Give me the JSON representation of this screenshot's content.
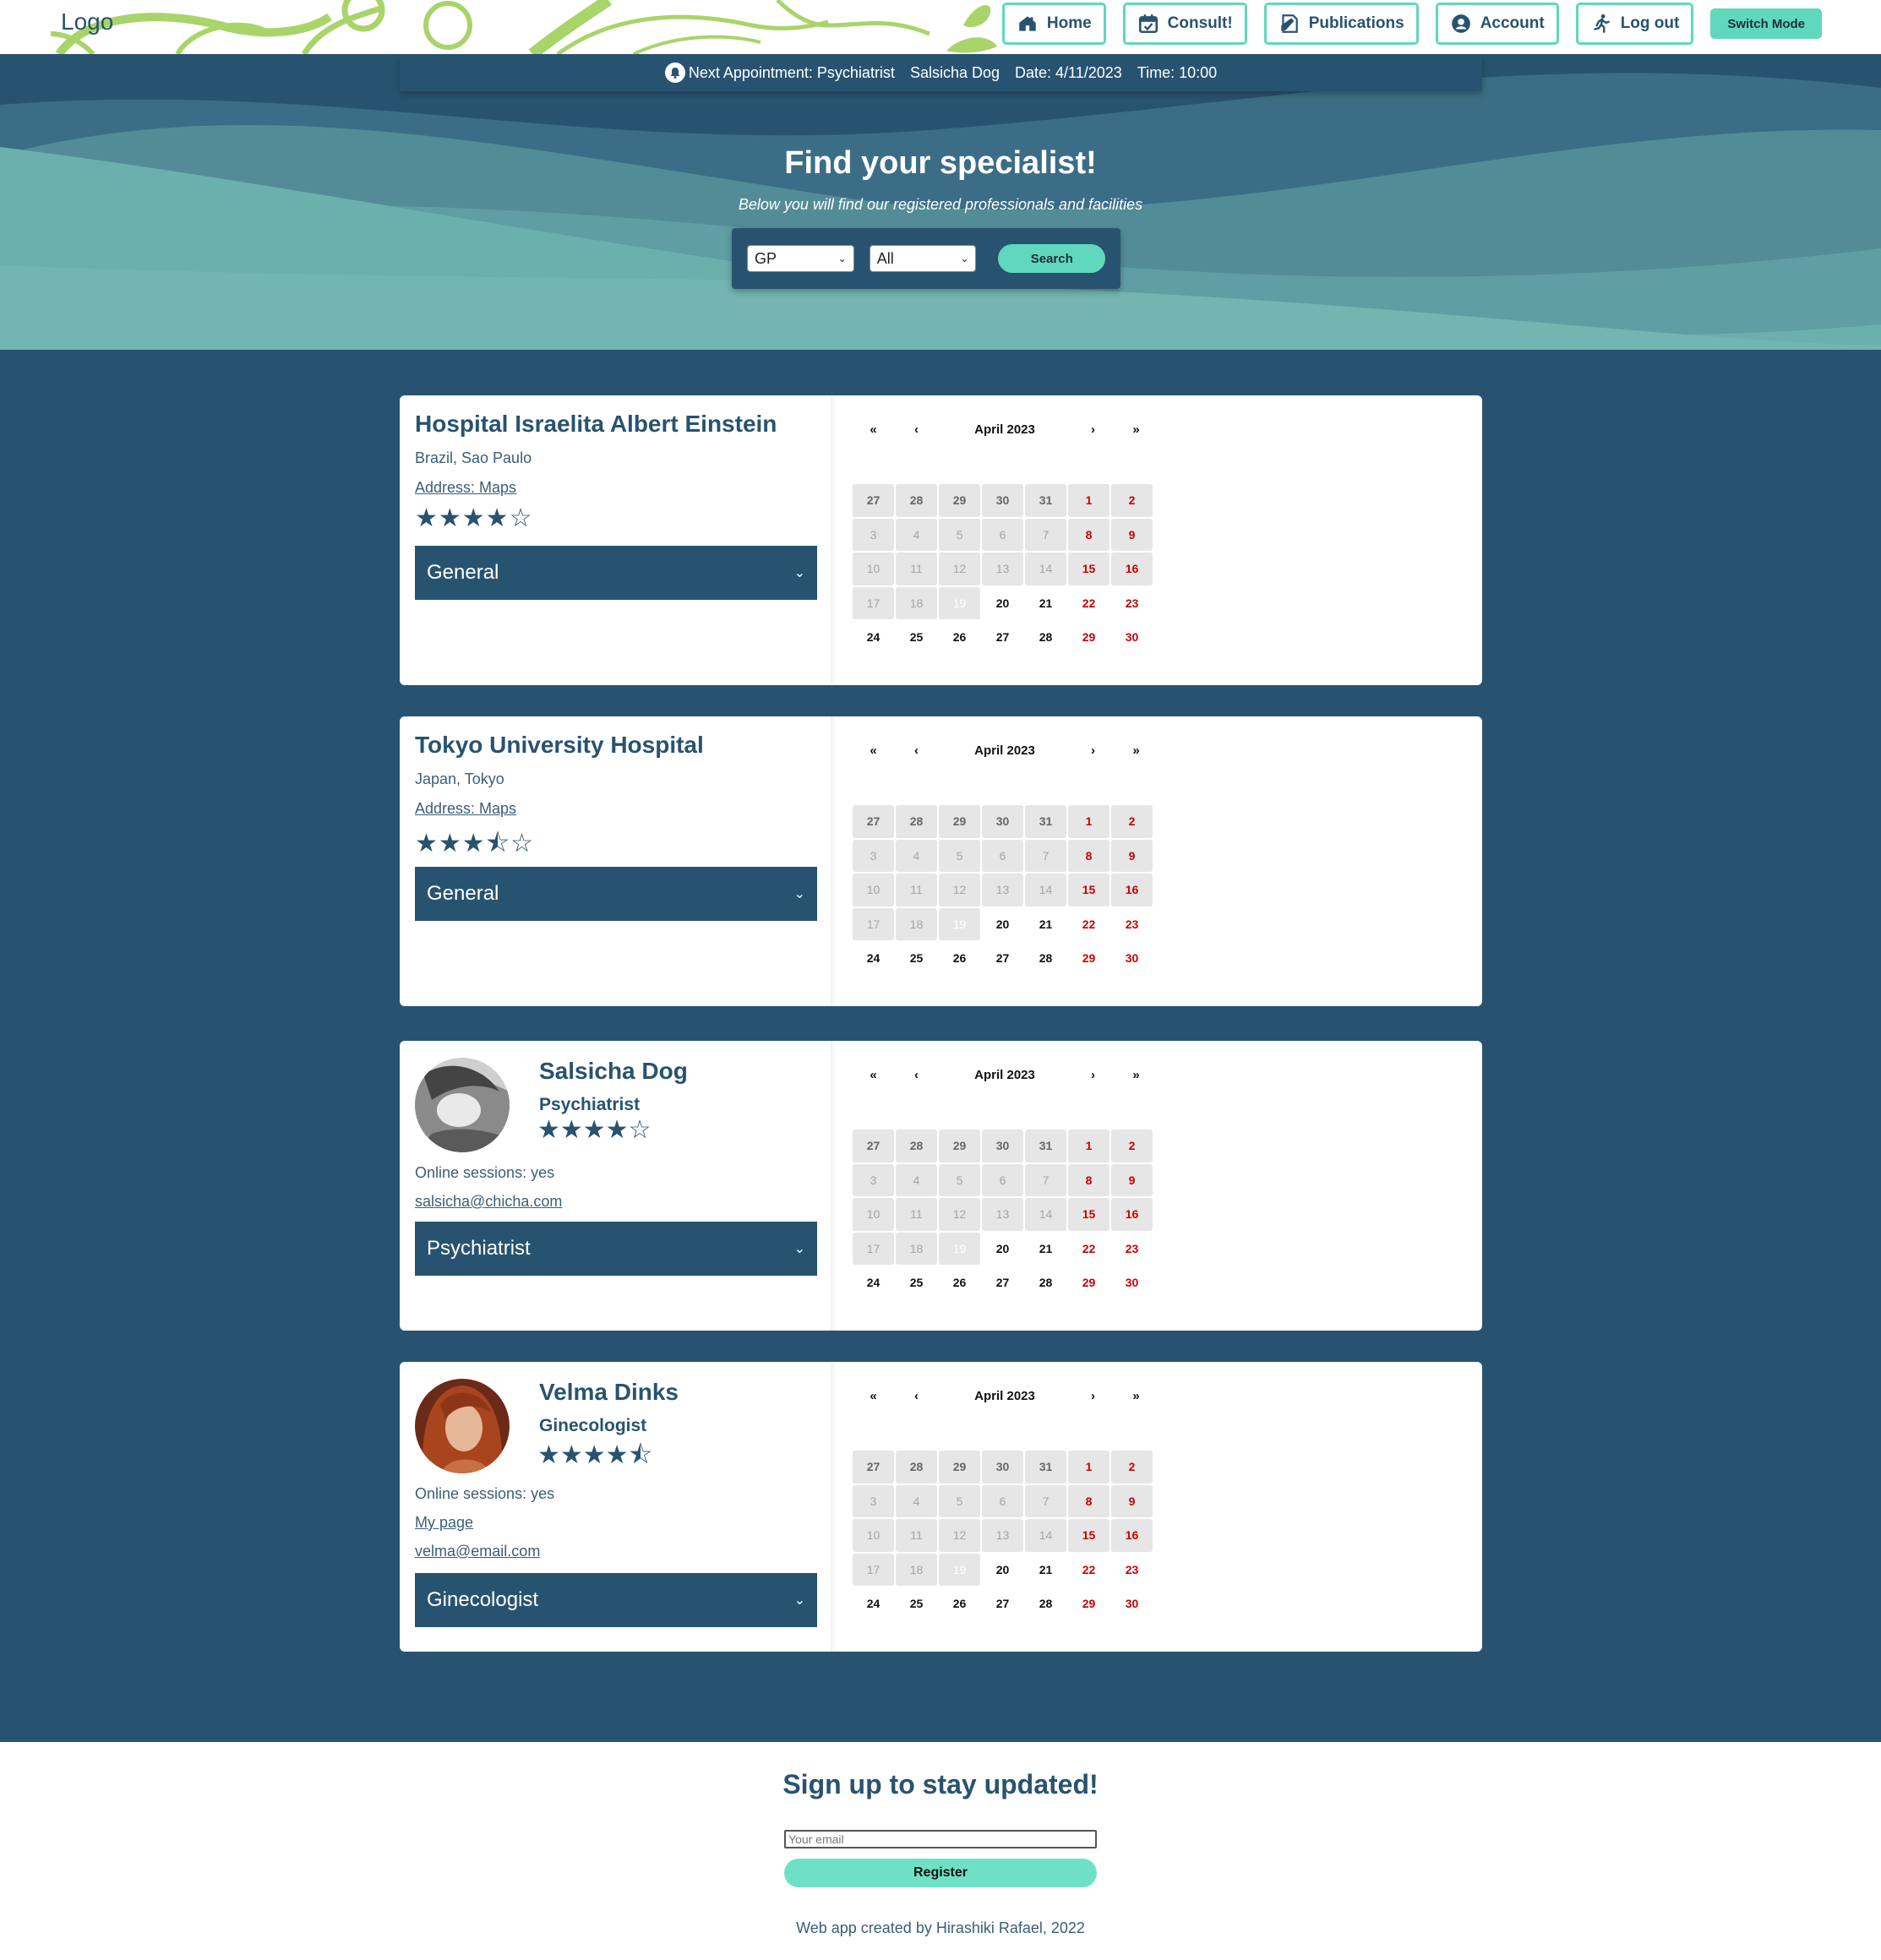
{
  "nav": {
    "logo": "Logo",
    "items": [
      {
        "label": "Home",
        "icon": "home-icon"
      },
      {
        "label": "Consult!",
        "icon": "calendar-icon"
      },
      {
        "label": "Publications",
        "icon": "publications-icon"
      },
      {
        "label": "Account",
        "icon": "account-icon"
      },
      {
        "label": "Log out",
        "icon": "run-icon"
      }
    ],
    "switch_mode": "Switch Mode"
  },
  "appointment": {
    "label": "Next Appointment: Psychiatrist",
    "doctor": "Salsicha Dog",
    "date": "Date: 4/11/2023",
    "time": "Time: 10:00"
  },
  "hero": {
    "title": "Find your specialist!",
    "subtitle": "Below you will find our registered professionals and facilities",
    "select_type": "GP",
    "select_filter": "All",
    "search_label": "Search"
  },
  "calendar": {
    "month": "April 2023",
    "nav": {
      "first": "«",
      "prev": "‹",
      "next": "›",
      "last": "»"
    },
    "weeks": [
      [
        "27",
        "28",
        "29",
        "30",
        "31",
        "1",
        "2"
      ],
      [
        "3",
        "4",
        "5",
        "6",
        "7",
        "8",
        "9"
      ],
      [
        "10",
        "11",
        "12",
        "13",
        "14",
        "15",
        "16"
      ],
      [
        "17",
        "18",
        "19",
        "20",
        "21",
        "22",
        "23"
      ],
      [
        "24",
        "25",
        "26",
        "27",
        "28",
        "29",
        "30"
      ]
    ]
  },
  "facilities": [
    {
      "name": "Hospital Israelita Albert Einstein",
      "location": "Brazil, Sao Paulo",
      "address": "Address: Maps",
      "stars": "★★★★☆",
      "rating": 4,
      "specialty": "General"
    },
    {
      "name": "Tokyo University Hospital",
      "location": "Japan, Tokyo",
      "address": "Address: Maps",
      "stars": "★★★⯪☆",
      "rating": 3.5,
      "specialty": "General"
    }
  ],
  "doctors": [
    {
      "name": "Salsicha Dog",
      "role": "Psychiatrist",
      "stars": "★★★★☆",
      "rating": 4,
      "online": "Online sessions: yes",
      "links": [
        "salsicha@chicha.com"
      ],
      "specialty": "Psychiatrist"
    },
    {
      "name": "Velma Dinks",
      "role": "Ginecologist",
      "stars": "★★★★⯪",
      "rating": 4.5,
      "online": "Online sessions: yes",
      "links": [
        "My page",
        "velma@email.com"
      ],
      "specialty": "Ginecologist"
    }
  ],
  "footer": {
    "title": "Sign up to stay updated!",
    "email_placeholder": "Your email",
    "register": "Register",
    "credit": "Web app created by Hirashiki Rafael, 2022"
  },
  "colors": {
    "primary": "#285370",
    "accent": "#5fd8bd",
    "weekend": "#cc0000"
  }
}
